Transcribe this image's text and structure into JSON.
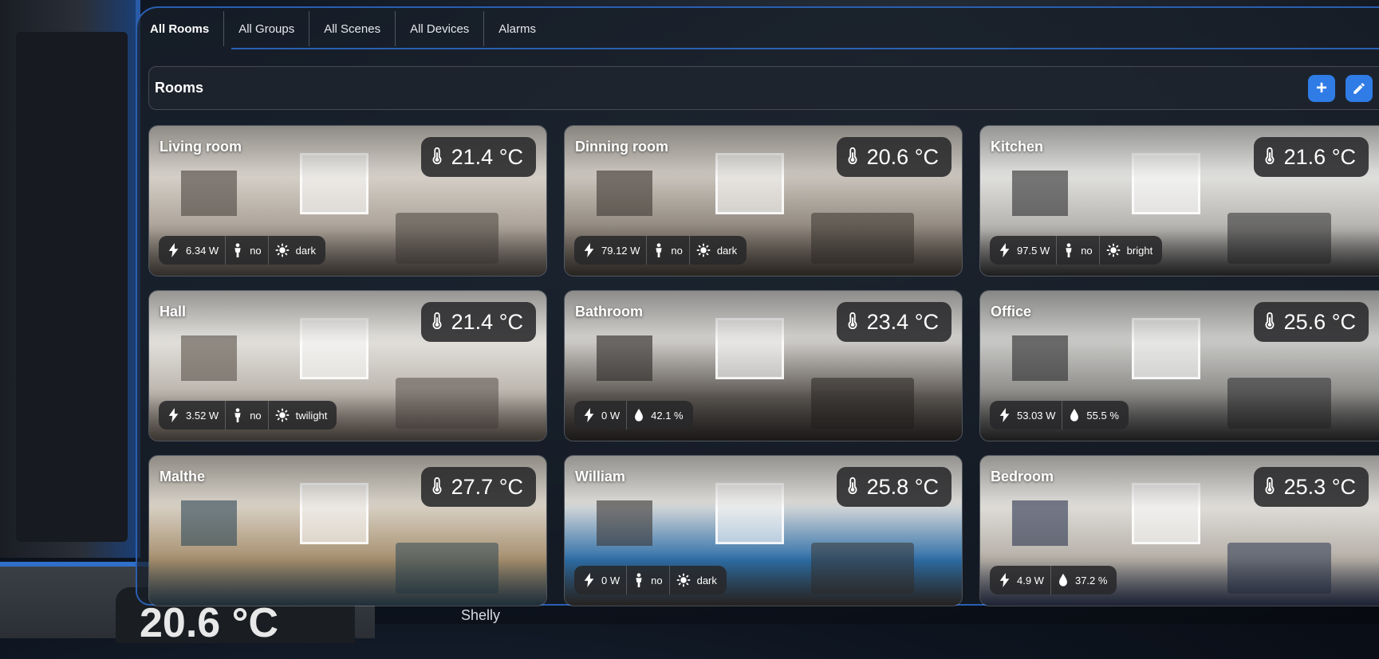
{
  "tabs": [
    {
      "label": "All Rooms",
      "active": true
    },
    {
      "label": "All Groups",
      "active": false
    },
    {
      "label": "All Scenes",
      "active": false
    },
    {
      "label": "All Devices",
      "active": false
    },
    {
      "label": "Alarms",
      "active": false
    }
  ],
  "rooms_header": {
    "title": "Rooms",
    "add_icon": "plus-icon",
    "edit_icon": "pencil-icon"
  },
  "rooms": [
    {
      "name": "Living room",
      "temperature": "21.4 °C",
      "power": "6.34 W",
      "presence": "no",
      "light": "dark",
      "humidity": null,
      "palette": [
        "#d9d4cc",
        "#a9a096",
        "#4b4540"
      ]
    },
    {
      "name": "Dinning room",
      "temperature": "20.6 °C",
      "power": "79.12 W",
      "presence": "no",
      "light": "dark",
      "humidity": null,
      "palette": [
        "#cfcac2",
        "#8e857b",
        "#3d3732"
      ]
    },
    {
      "name": "Kitchen",
      "temperature": "21.6 °C",
      "power": "97.5 W",
      "presence": "no",
      "light": "bright",
      "humidity": null,
      "palette": [
        "#e4e4e2",
        "#b3b1ad",
        "#2e2e30"
      ]
    },
    {
      "name": "Hall",
      "temperature": "21.4 °C",
      "power": "3.52 W",
      "presence": "no",
      "light": "twilight",
      "humidity": null,
      "palette": [
        "#e6e4e0",
        "#b9b3ab",
        "#5a514a"
      ]
    },
    {
      "name": "Bathroom",
      "temperature": "23.4 °C",
      "power": "0 W",
      "presence": null,
      "light": null,
      "humidity": "42.1 %",
      "palette": [
        "#d8d6d3",
        "#5e5955",
        "#2a2725"
      ]
    },
    {
      "name": "Office",
      "temperature": "25.6 °C",
      "power": "53.03 W",
      "presence": null,
      "light": null,
      "humidity": "55.5 %",
      "palette": [
        "#cfcfcd",
        "#8a8986",
        "#2b2b2d"
      ]
    },
    {
      "name": "Malthe",
      "temperature": "27.7 °C",
      "power": null,
      "presence": null,
      "light": null,
      "humidity": null,
      "palette": [
        "#dcd6cc",
        "#a68f6e",
        "#2f4858"
      ]
    },
    {
      "name": "William",
      "temperature": "25.8 °C",
      "power": "0 W",
      "presence": "no",
      "light": "dark",
      "humidity": null,
      "palette": [
        "#e2e0dc",
        "#2e6fa8",
        "#3a3633"
      ]
    },
    {
      "name": "Bedroom",
      "temperature": "25.3 °C",
      "power": "4.9 W",
      "presence": null,
      "light": null,
      "humidity": "37.2 %",
      "palette": [
        "#e3e1dd",
        "#b4aea6",
        "#2c3650"
      ]
    }
  ],
  "background": {
    "footer_label": "Shelly",
    "big_temp": "20.6 °C"
  },
  "colors": {
    "accent": "#2f7ce6",
    "panel_border": "#2a5fb0"
  }
}
